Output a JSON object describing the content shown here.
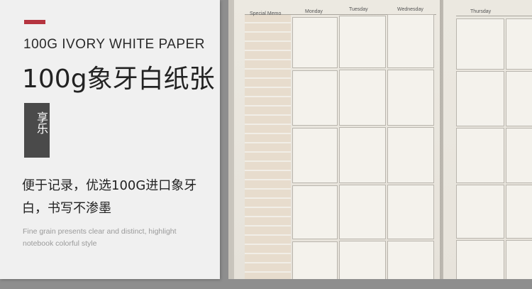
{
  "left_panel": {
    "english_title": "100G IVORY WHITE PAPER",
    "chinese_title": "100g象牙白纸张",
    "badge": "享乐",
    "chinese_description": "便于记录，优选100G进口象牙白，书写不渗墨",
    "english_description": "Fine grain presents clear and distinct, highlight notebook colorful style",
    "accent_color": "#b5343f"
  },
  "notebook": {
    "columns": [
      "Special Memo",
      "Monday",
      "Tuesday",
      "Wednesday",
      "Thursday"
    ]
  }
}
